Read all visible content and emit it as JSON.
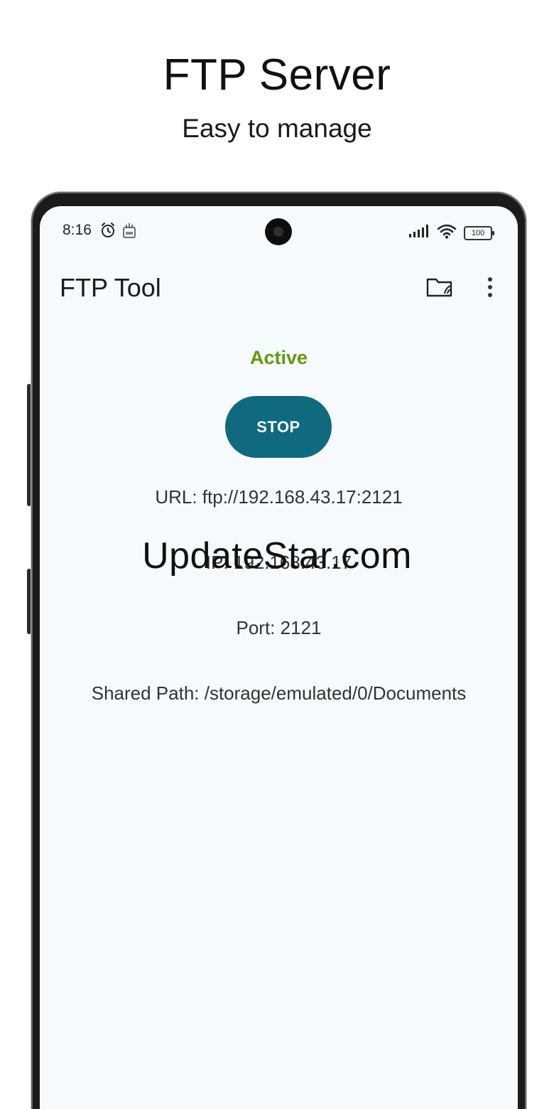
{
  "promo": {
    "title": "FTP Server",
    "subtitle": "Easy to manage"
  },
  "status_bar": {
    "time": "8:16",
    "battery": "100",
    "left_icons": [
      "alarm-icon",
      "ftp-notification-icon"
    ],
    "right_icons": [
      "signal-icon",
      "wifi-icon",
      "battery-icon"
    ]
  },
  "app_bar": {
    "title": "FTP Tool",
    "actions": [
      "folder-icon",
      "more-vert-icon"
    ]
  },
  "server": {
    "status": "Active",
    "button_label": "STOP",
    "url": "URL: ftp://192.168.43.17:2121",
    "ip": "IP: 192.168.43.17",
    "port": "Port: 2121",
    "shared_path": "Shared Path: /storage/emulated/0/Documents"
  },
  "watermark": "UpdateStar.com",
  "colors": {
    "status_active": "#5f9a0c",
    "button_bg": "#0f6a7f",
    "screen_bg": "#f7fafc"
  }
}
